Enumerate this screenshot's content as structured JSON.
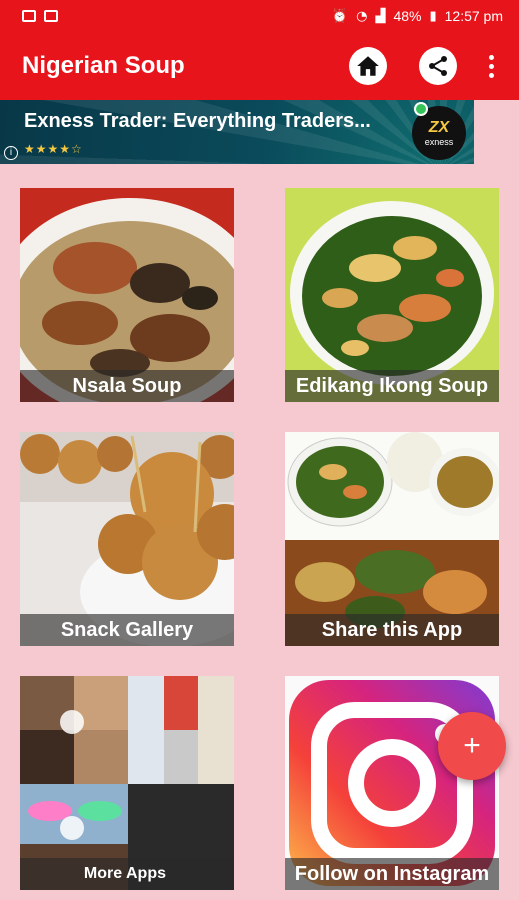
{
  "status_bar": {
    "battery": "48%",
    "time": "12:57 pm"
  },
  "app_bar": {
    "title": "Nigerian Soup",
    "icons": [
      "home-icon",
      "share-icon",
      "more-vert-icon"
    ]
  },
  "ad_banner": {
    "title": "Exness Trader: Everything Traders...",
    "rating_stars": "★★★★☆",
    "info_glyph": "i",
    "logo_mark": "ZX",
    "logo_name": "exness"
  },
  "tiles": [
    {
      "label": "Nsala Soup"
    },
    {
      "label": "Edikang Ikong Soup"
    },
    {
      "label": "Snack Gallery"
    },
    {
      "label": "Share this App"
    },
    {
      "label": "More Apps"
    },
    {
      "label": "Follow on Instagram"
    }
  ],
  "fab": {
    "label": "+"
  },
  "colors": {
    "primary": "#e8141b",
    "background": "#f6c8cf",
    "fab": "#f04a4a"
  }
}
